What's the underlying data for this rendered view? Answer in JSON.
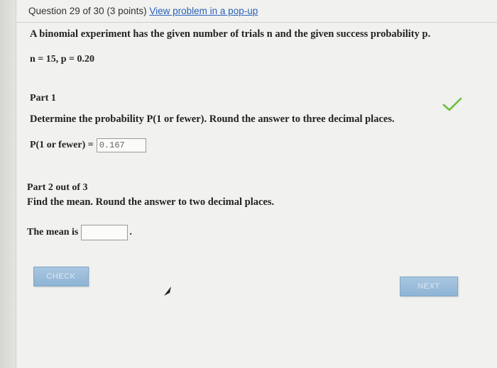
{
  "header": {
    "question": "Question 29 of 30 (3 points)",
    "popup_link": "View problem in a pop-up"
  },
  "problem": {
    "statement": "A binomial experiment has the given number of trials n and the given success probability p.",
    "givens": "n = 15, p = 0.20"
  },
  "part1": {
    "title": "Part 1",
    "prompt": "Determine the probability P(1 or fewer). Round the answer to three decimal places.",
    "answer_label": "P(1 or fewer) =",
    "answer_value": "0.167",
    "status_icon": "checkmark-icon",
    "status_color": "#6cbf3a"
  },
  "part2": {
    "title": "Part 2 out of 3",
    "prompt": "Find the mean. Round the answer to two decimal places.",
    "answer_label": "The mean is",
    "answer_value": "",
    "answer_suffix": "."
  },
  "buttons": {
    "check_label": "CHECK",
    "next_label": "NEXT"
  },
  "colors": {
    "link": "#2a62b8",
    "button_bg": "#98bcda"
  }
}
